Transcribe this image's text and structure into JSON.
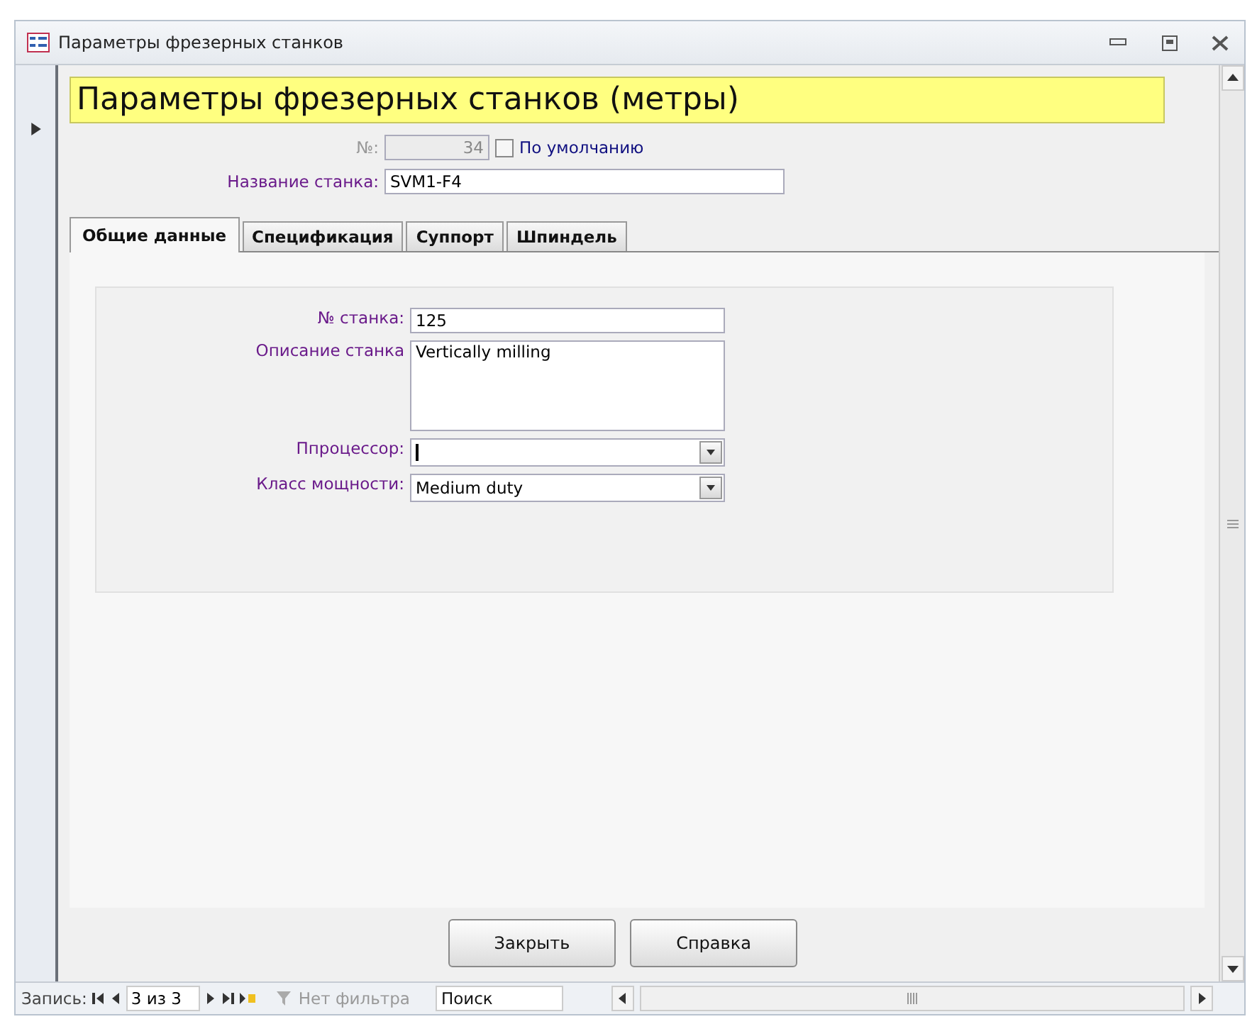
{
  "window": {
    "title": "Параметры фрезерных станков"
  },
  "form_title": "Параметры фрезерных станков (метры)",
  "header_fields": {
    "number": {
      "label": "№:",
      "value": "34",
      "disabled": true
    },
    "default": {
      "label": "По умолчанию",
      "checked": false
    },
    "name": {
      "label": "Название станка:",
      "value": "SVM1-F4"
    }
  },
  "tabs": [
    {
      "label": "Общие данные",
      "selected": true
    },
    {
      "label": "Спецификация",
      "selected": false
    },
    {
      "label": "Суппорт",
      "selected": false
    },
    {
      "label": "Шпиндель",
      "selected": false
    }
  ],
  "tab_fields": [
    {
      "kind": "text",
      "label": "№ станка:",
      "value": "125"
    },
    {
      "kind": "memo",
      "label": "Описание станка",
      "value": "Vertically milling"
    },
    {
      "kind": "combo",
      "label": "Ппроцессор:"
    },
    {
      "kind": "combo",
      "label": "Класс мощности:",
      "value": "Medium duty"
    }
  ],
  "buttons": [
    "Закрыть",
    "Справка"
  ],
  "navigation": {
    "label": "Запись:",
    "position": "3 из 3",
    "filter": "Нет фильтра",
    "search": {
      "placeholder": "Поиск"
    }
  }
}
